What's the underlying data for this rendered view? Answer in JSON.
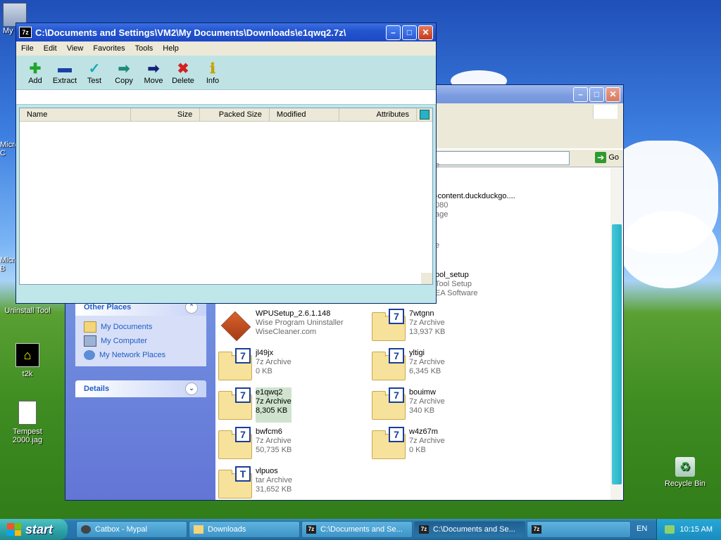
{
  "desktop": {
    "icons": [
      {
        "label": "My"
      },
      {
        "label": "Micro C"
      },
      {
        "label": "Micro B"
      },
      {
        "label": "Uninstall Tool"
      },
      {
        "label": "t2k"
      },
      {
        "label": "Tempest 2000.jag"
      },
      {
        "label": "Recycle Bin"
      }
    ]
  },
  "explorer": {
    "go_label": "Go",
    "partial_texts": [
      "e",
      "-content.duckduckgo....",
      "080",
      "age",
      "e",
      "ool_setup",
      "Tool Setup",
      "EA Software"
    ],
    "other_places": {
      "title": "Other Places",
      "links": [
        "My Documents",
        "My Computer",
        "My Network Places"
      ]
    },
    "details": {
      "title": "Details"
    },
    "files": [
      {
        "name": "WPUSetup_2.6.1.148",
        "type": "Wise Program Uninstaller",
        "size": "WiseCleaner.com",
        "icon": "installer-box-icon"
      },
      {
        "name": "7wtgnn",
        "type": "7z Archive",
        "size": "13,937 KB",
        "icon": "7z"
      },
      {
        "name": "jl49jx",
        "type": "7z Archive",
        "size": "0 KB",
        "icon": "7z"
      },
      {
        "name": "yltigi",
        "type": "7z Archive",
        "size": "6,345 KB",
        "icon": "7z"
      },
      {
        "name": "e1qwq2",
        "type": "7z Archive",
        "size": "8,305 KB",
        "icon": "7z"
      },
      {
        "name": "bouimw",
        "type": "7z Archive",
        "size": "340 KB",
        "icon": "7z"
      },
      {
        "name": "bwfcm6",
        "type": "7z Archive",
        "size": "50,735 KB",
        "icon": "7z"
      },
      {
        "name": "w4z67m",
        "type": "7z Archive",
        "size": "0 KB",
        "icon": "7z"
      },
      {
        "name": "vlpuos",
        "type": "tar Archive",
        "size": "31,652 KB",
        "icon": "tar"
      }
    ]
  },
  "zip": {
    "title": "C:\\Documents and Settings\\VM2\\My Documents\\Downloads\\e1qwq2.7z\\",
    "app_icon": "7z",
    "menu": [
      "File",
      "Edit",
      "View",
      "Favorites",
      "Tools",
      "Help"
    ],
    "tools": [
      {
        "label": "Add",
        "glyph": "✚",
        "color": "#21a52f"
      },
      {
        "label": "Extract",
        "glyph": "▬",
        "color": "#1b3fa8"
      },
      {
        "label": "Test",
        "glyph": "✓",
        "color": "#1aa9b8"
      },
      {
        "label": "Copy",
        "glyph": "➡",
        "color": "#1e8a7a"
      },
      {
        "label": "Move",
        "glyph": "➡",
        "color": "#14217a"
      },
      {
        "label": "Delete",
        "glyph": "✖",
        "color": "#d42020"
      },
      {
        "label": "Info",
        "glyph": "ℹ",
        "color": "#c9a000"
      }
    ],
    "columns": [
      "Name",
      "Size",
      "Packed Size",
      "Modified",
      "Attributes"
    ]
  },
  "taskbar": {
    "start_label": "start",
    "tasks": [
      {
        "label": "Catbox - Mypal",
        "icon": "mypal-icon"
      },
      {
        "label": "Downloads",
        "icon": "folder-icon"
      },
      {
        "label": "C:\\Documents and Se...",
        "icon": "7z"
      },
      {
        "label": "C:\\Documents and Se...",
        "icon": "7z"
      },
      {
        "label": "",
        "icon": "7z"
      }
    ],
    "language": "EN",
    "clock": "10:15 AM"
  }
}
